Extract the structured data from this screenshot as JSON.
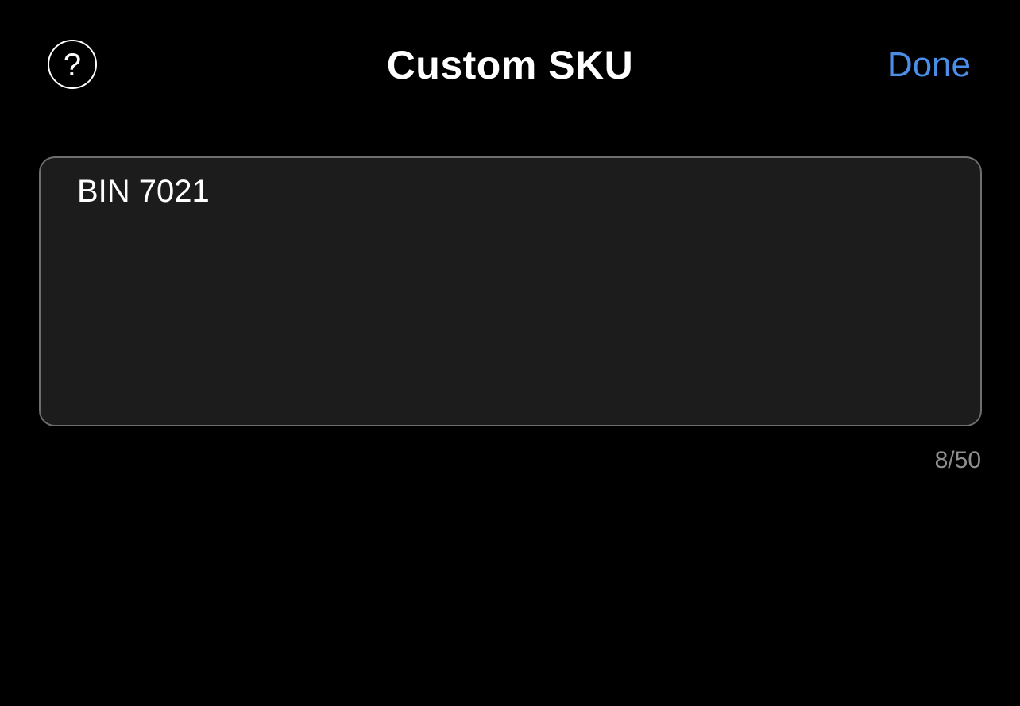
{
  "header": {
    "help_icon": "question-mark-circle-icon",
    "help_glyph": "?",
    "title": "Custom SKU",
    "done_label": "Done"
  },
  "sku_field": {
    "value": "BIN 7021",
    "counter": "8/50",
    "max_length": 50
  },
  "colors": {
    "accent": "#4a8fe7",
    "background": "#000000",
    "field_background": "#1c1c1c",
    "field_border": "#6e6e6e",
    "counter_text": "#8e8e8e"
  }
}
